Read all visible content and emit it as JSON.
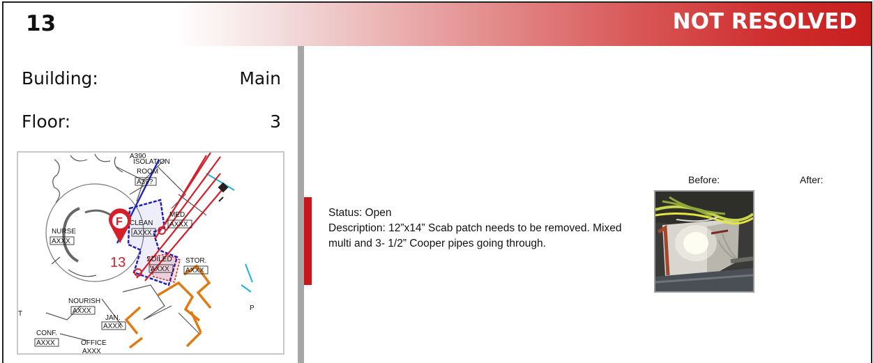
{
  "header": {
    "issue_number": "13",
    "status_banner": "NOT RESOLVED"
  },
  "location": {
    "building_label": "Building:",
    "building_value": "Main",
    "floor_label": "Floor:",
    "floor_value": "3"
  },
  "floor_plan": {
    "marker_letter": "F",
    "marker_number": "13",
    "room_labels": {
      "top_tag": "A390",
      "isolation": "ISOLATION",
      "room": "ROOM",
      "room_tag": "A39?",
      "nurse": "NURSE",
      "nurse_tag": "AXXX",
      "clean": "CLEAN",
      "clean_tag": "AXXX",
      "med": "MED.",
      "med_tag": "AXXX",
      "soiled": "SOILED",
      "soiled_tag": "AXXX",
      "stor": "STOR.",
      "stor_tag": "AXXX",
      "nourish": "NOURISH",
      "nourish_tag": "AXXX",
      "jan": "JAN.",
      "jan_tag": "AXXX",
      "conf": "CONF.",
      "conf_tag": "AXXX",
      "office": "OFFICE",
      "office_tag": "AXXX",
      "edge_p": "P",
      "edge_t": "T"
    }
  },
  "details": {
    "status": "Status: Open",
    "description": "Description: 12”x14” Scab patch needs to be removed. Mixed multi and 3- 1/2” Cooper pipes going through."
  },
  "photos": {
    "before_label": "Before:",
    "after_label": "After:"
  },
  "colors": {
    "accent_red": "#c8161d",
    "divider_gray": "#a6a6a6"
  }
}
